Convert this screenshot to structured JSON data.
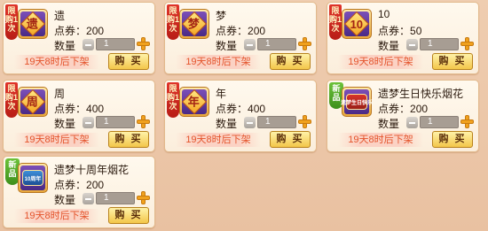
{
  "shop": {
    "price_label": "点券：",
    "qty_label": "数量",
    "buy_label": "购 买",
    "items": [
      {
        "name": "遗",
        "badge": "限购1次",
        "badge_type": "limit",
        "icon": "yi-diamond-icon",
        "glyph": "遗",
        "price": "200",
        "qty": "1",
        "timer": "19天8时后下架"
      },
      {
        "name": "梦",
        "badge": "限购1次",
        "badge_type": "limit",
        "icon": "meng-diamond-icon",
        "glyph": "梦",
        "price": "200",
        "qty": "1",
        "timer": "19天8时后下架"
      },
      {
        "name": "10",
        "badge": "限购1次",
        "badge_type": "limit",
        "icon": "ten-diamond-icon",
        "glyph": "10",
        "price": "50",
        "qty": "1",
        "timer": "19天8时后下架"
      },
      {
        "name": "周",
        "badge": "限购1次",
        "badge_type": "limit",
        "icon": "zhou-diamond-icon",
        "glyph": "周",
        "price": "400",
        "qty": "1",
        "timer": "19天8时后下架"
      },
      {
        "name": "年",
        "badge": "限购1次",
        "badge_type": "limit",
        "icon": "nian-diamond-icon",
        "glyph": "年",
        "price": "400",
        "qty": "1",
        "timer": "19天8时后下架"
      },
      {
        "name": "遗梦生日快乐烟花",
        "badge": "新品",
        "badge_type": "new",
        "icon": "birthday-firework-icon",
        "glyph": "遗梦生日快乐",
        "price": "200",
        "qty": "1",
        "timer": "19天8时后下架"
      },
      {
        "name": "遗梦十周年烟花",
        "badge": "新品",
        "badge_type": "new",
        "icon": "anniversary-firework-icon",
        "glyph": "10周年",
        "price": "200",
        "qty": "1",
        "timer": "19天8时后下架"
      }
    ]
  }
}
